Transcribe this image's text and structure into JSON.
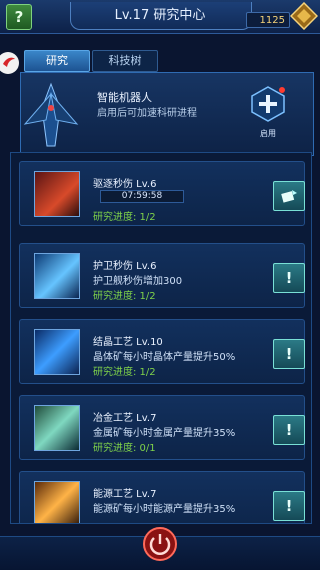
{
  "header": {
    "title": "Lv.17 研究中心",
    "resource_amount": "1125",
    "help_symbol": "?"
  },
  "tabs": [
    {
      "label": "研究",
      "active": true
    },
    {
      "label": "科技树",
      "active": false
    }
  ],
  "robot": {
    "name": "智能机器人",
    "desc": "启用后可加速科研进程",
    "activate_label": "启用"
  },
  "research_items": [
    {
      "name": "驱逐秒伤 Lv.6",
      "timer": "07:59:58",
      "desc": "",
      "progress": "研究进度: 1/2",
      "action_icon": "speedup-icon"
    },
    {
      "name": "护卫秒伤 Lv.6",
      "timer": "",
      "desc": "护卫舰秒伤增加300",
      "progress": "研究进度: 1/2",
      "action_icon": "exclamation-icon"
    },
    {
      "name": "结晶工艺 Lv.10",
      "timer": "",
      "desc": "晶体矿每小时晶体产量提升50%",
      "progress": "研究进度: 1/2",
      "action_icon": "exclamation-icon"
    },
    {
      "name": "冶金工艺 Lv.7",
      "timer": "",
      "desc": "金属矿每小时金属产量提升35%",
      "progress": "研究进度: 0/1",
      "action_icon": "exclamation-icon"
    },
    {
      "name": "能源工艺 Lv.7",
      "timer": "",
      "desc": "能源矿每小时能源产量提升35%",
      "progress": "",
      "action_icon": "exclamation-icon"
    }
  ],
  "colors": {
    "accent": "#3a86c9",
    "progress_green": "#7fd24a",
    "action_teal": "#2b7a86"
  }
}
